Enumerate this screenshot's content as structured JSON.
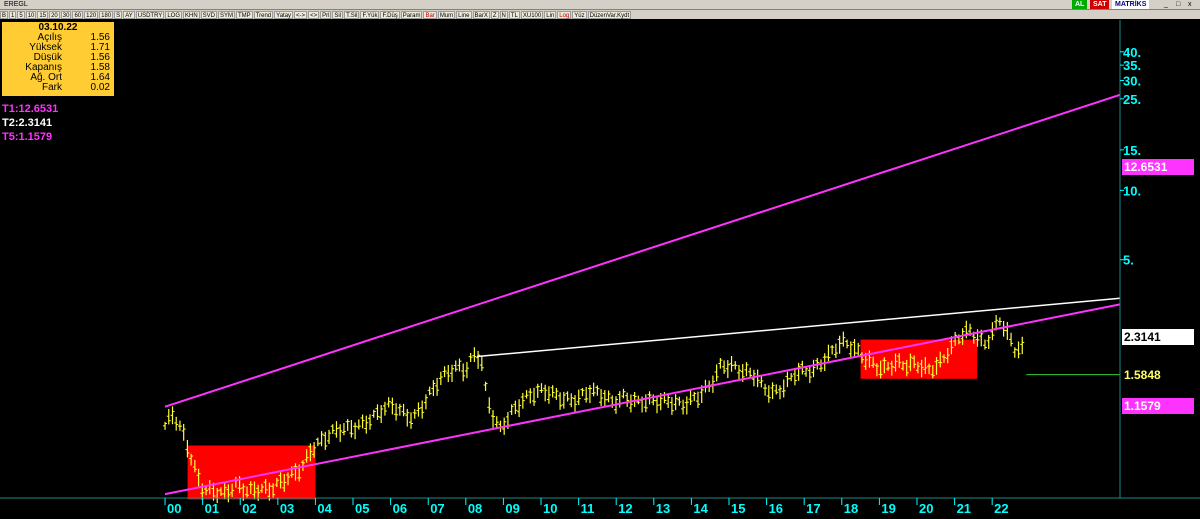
{
  "window": {
    "symbol": "EREGL",
    "badges": {
      "al": "AL",
      "sat": "SAT",
      "brand": "MATRİKS"
    },
    "controls": [
      "_",
      "□",
      "x"
    ]
  },
  "toolbar": {
    "items": [
      "B",
      "1",
      "5",
      "10",
      "15",
      "20",
      "30",
      "60",
      "120",
      "180",
      "S",
      "AY",
      "USDTRY",
      "LOG",
      "KHN",
      "SVD",
      "SYM",
      "TMP",
      "Trend",
      "Yatay",
      "<->",
      "<>",
      "Prl",
      "Sil",
      "T.Sil",
      "F.Yük",
      "F.Düş",
      "Param",
      "Bar",
      "Mum",
      "Line",
      "BarX",
      "Z",
      "N",
      "TL",
      "XU100",
      "Lin",
      "Log",
      "Yüz",
      "DüzenVar.Kydt"
    ],
    "active": [
      "Bar",
      "Log"
    ]
  },
  "info": {
    "date": "03.10.22",
    "rows": [
      {
        "label": "Açılış",
        "value": "1.56"
      },
      {
        "label": "Yüksek",
        "value": "1.71"
      },
      {
        "label": "Düşük",
        "value": "1.56"
      },
      {
        "label": "Kapanış",
        "value": "1.58"
      },
      {
        "label": "Ağ. Ort",
        "value": "1.64"
      },
      {
        "label": "Fark",
        "value": "0.02"
      }
    ]
  },
  "trend_labels": [
    {
      "text": "T1:12.6531",
      "color": "#ff33ff"
    },
    {
      "text": "T2:2.3141",
      "color": "#ffffff"
    },
    {
      "text": "T5:1.1579",
      "color": "#ff33ff"
    }
  ],
  "price_tags": [
    {
      "value": "12.6531",
      "bg": "#ff33ff",
      "fg": "#ffffff"
    },
    {
      "value": "2.3141",
      "bg": "#ffffff",
      "fg": "#000000"
    },
    {
      "value": "1.5848",
      "bg": "#000000",
      "fg": "#ffff66"
    },
    {
      "value": "1.1579",
      "bg": "#ff33ff",
      "fg": "#ffffff"
    }
  ],
  "chart_data": {
    "type": "bar",
    "scale": "log",
    "ylim": [
      0.5,
      45
    ],
    "y_ticks": [
      5,
      10,
      15,
      25,
      30,
      35,
      40
    ],
    "y_tick_labels": [
      "5.",
      "10.",
      "15.",
      "25.",
      "30.",
      "35.",
      "40."
    ],
    "x_ticks": [
      "00",
      "01",
      "02",
      "03",
      "04",
      "05",
      "06",
      "07",
      "08",
      "09",
      "10",
      "11",
      "12",
      "13",
      "14",
      "15",
      "16",
      "17",
      "18",
      "19",
      "20",
      "21",
      "22"
    ],
    "x_tick_years": [
      2000,
      2001,
      2002,
      2003,
      2004,
      2005,
      2006,
      2007,
      2008,
      2009,
      2010,
      2011,
      2012,
      2013,
      2014,
      2015,
      2016,
      2017,
      2018,
      2019,
      2020,
      2021,
      2022
    ],
    "xlim": [
      1999.6,
      2025.4
    ],
    "series_color": "#ffff33",
    "price_path": [
      [
        2000.0,
        0.95
      ],
      [
        2000.2,
        1.05
      ],
      [
        2000.5,
        0.85
      ],
      [
        2000.8,
        0.62
      ],
      [
        2001.0,
        0.52
      ],
      [
        2001.3,
        0.5
      ],
      [
        2001.6,
        0.47
      ],
      [
        2001.9,
        0.52
      ],
      [
        2002.2,
        0.5
      ],
      [
        2002.5,
        0.52
      ],
      [
        2002.8,
        0.5
      ],
      [
        2003.1,
        0.53
      ],
      [
        2003.4,
        0.58
      ],
      [
        2003.7,
        0.66
      ],
      [
        2003.9,
        0.78
      ],
      [
        2004.2,
        0.82
      ],
      [
        2004.5,
        0.88
      ],
      [
        2004.8,
        0.92
      ],
      [
        2005.2,
        0.98
      ],
      [
        2005.6,
        1.05
      ],
      [
        2006.0,
        1.15
      ],
      [
        2006.3,
        1.1
      ],
      [
        2006.6,
        1.05
      ],
      [
        2006.9,
        1.2
      ],
      [
        2007.2,
        1.4
      ],
      [
        2007.5,
        1.6
      ],
      [
        2007.8,
        1.75
      ],
      [
        2008.0,
        1.7
      ],
      [
        2008.2,
        1.95
      ],
      [
        2008.4,
        1.88
      ],
      [
        2008.55,
        1.25
      ],
      [
        2008.75,
        1.0
      ],
      [
        2008.9,
        0.9
      ],
      [
        2009.2,
        1.1
      ],
      [
        2009.5,
        1.25
      ],
      [
        2009.8,
        1.3
      ],
      [
        2010.1,
        1.32
      ],
      [
        2010.5,
        1.28
      ],
      [
        2010.9,
        1.25
      ],
      [
        2011.3,
        1.32
      ],
      [
        2011.6,
        1.28
      ],
      [
        2011.9,
        1.22
      ],
      [
        2012.2,
        1.3
      ],
      [
        2012.6,
        1.18
      ],
      [
        2013.0,
        1.2
      ],
      [
        2013.4,
        1.25
      ],
      [
        2013.8,
        1.18
      ],
      [
        2014.2,
        1.25
      ],
      [
        2014.5,
        1.42
      ],
      [
        2014.8,
        1.8
      ],
      [
        2015.1,
        1.75
      ],
      [
        2015.4,
        1.6
      ],
      [
        2015.7,
        1.55
      ],
      [
        2015.9,
        1.4
      ],
      [
        2016.2,
        1.35
      ],
      [
        2016.5,
        1.45
      ],
      [
        2016.8,
        1.6
      ],
      [
        2017.2,
        1.62
      ],
      [
        2017.5,
        1.85
      ],
      [
        2017.8,
        2.1
      ],
      [
        2018.0,
        2.2
      ],
      [
        2018.2,
        2.1
      ],
      [
        2018.5,
        1.9
      ],
      [
        2018.8,
        1.8
      ],
      [
        2019.1,
        1.72
      ],
      [
        2019.4,
        1.78
      ],
      [
        2019.7,
        1.7
      ],
      [
        2020.0,
        1.75
      ],
      [
        2020.3,
        1.7
      ],
      [
        2020.6,
        1.8
      ],
      [
        2020.85,
        2.0
      ],
      [
        2021.1,
        2.25
      ],
      [
        2021.4,
        2.45
      ],
      [
        2021.6,
        2.35
      ],
      [
        2021.8,
        2.2
      ],
      [
        2022.0,
        2.45
      ],
      [
        2022.2,
        2.75
      ],
      [
        2022.4,
        2.35
      ],
      [
        2022.6,
        2.0
      ],
      [
        2022.8,
        2.05
      ]
    ],
    "last_value": 1.5848,
    "channel_upper": [
      [
        2000.0,
        1.15
      ],
      [
        2025.4,
        26.0
      ]
    ],
    "channel_lower": [
      [
        2000.0,
        0.48
      ],
      [
        2025.4,
        3.2
      ]
    ],
    "resistance_line": [
      [
        2008.3,
        1.9
      ],
      [
        2025.4,
        3.4
      ]
    ],
    "boxes": [
      {
        "from": 2000.6,
        "to": 2004.0,
        "low": 0.455,
        "high": 0.78,
        "color": "#ff0000"
      },
      {
        "from": 2018.5,
        "to": 2021.6,
        "low": 1.52,
        "high": 2.25,
        "color": "#ff0000"
      }
    ],
    "colors": {
      "bars": "#ffff33",
      "channel": "#ff33ff",
      "resistance": "#ffffff",
      "boxes": "#ff0000",
      "axis": "#00ffff"
    }
  }
}
